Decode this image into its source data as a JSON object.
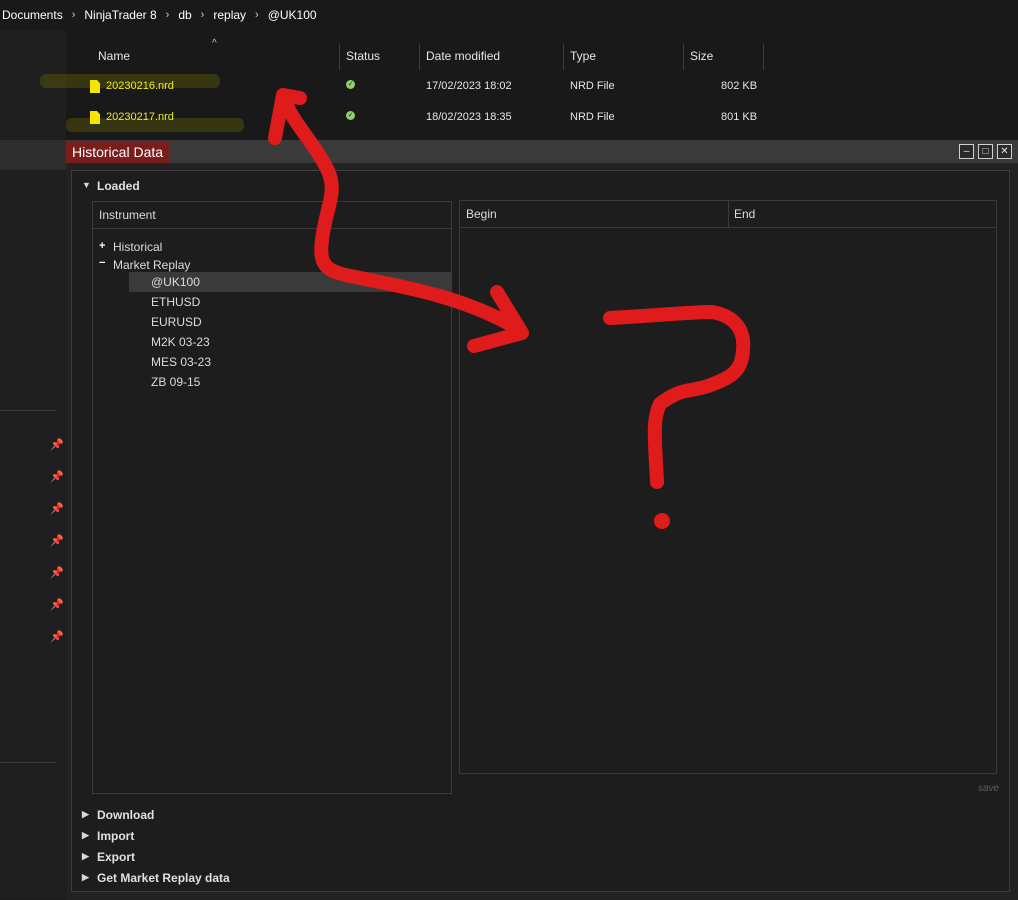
{
  "breadcrumb": [
    "Documents",
    "NinjaTrader 8",
    "db",
    "replay",
    "@UK100"
  ],
  "file_list": {
    "columns": [
      "Name",
      "Status",
      "Date modified",
      "Type",
      "Size"
    ],
    "files": [
      {
        "name": "20230216.nrd",
        "status_icon": "check-circle-icon",
        "date_modified": "17/02/2023 18:02",
        "type": "NRD File",
        "size": "802 KB"
      },
      {
        "name": "20230217.nrd",
        "status_icon": "check-circle-icon",
        "date_modified": "18/02/2023 18:35",
        "type": "NRD File",
        "size": "801 KB"
      }
    ]
  },
  "window": {
    "title": "Historical Data",
    "controls": [
      "minimize-icon",
      "maximize-icon",
      "close-icon"
    ]
  },
  "loaded": {
    "label": "Loaded",
    "instrument_header": "Instrument",
    "tree": {
      "historical": {
        "toggle": "+",
        "label": "Historical"
      },
      "market_replay": {
        "toggle": "−",
        "label": "Market Replay",
        "items": [
          "@UK100",
          "ETHUSD",
          "EURUSD",
          "M2K 03-23",
          "MES 03-23",
          "ZB 09-15"
        ],
        "selected": "@UK100"
      }
    },
    "range_columns": {
      "begin": "Begin",
      "end": "End"
    },
    "save_label": "save"
  },
  "sections": [
    "Download",
    "Import",
    "Export",
    "Get Market Replay data"
  ],
  "colors": {
    "title_tab": "#7a1d1d",
    "file_name": "#ecec1c",
    "annotation": "#e01b1b",
    "status_ok": "#8fcf6a"
  }
}
